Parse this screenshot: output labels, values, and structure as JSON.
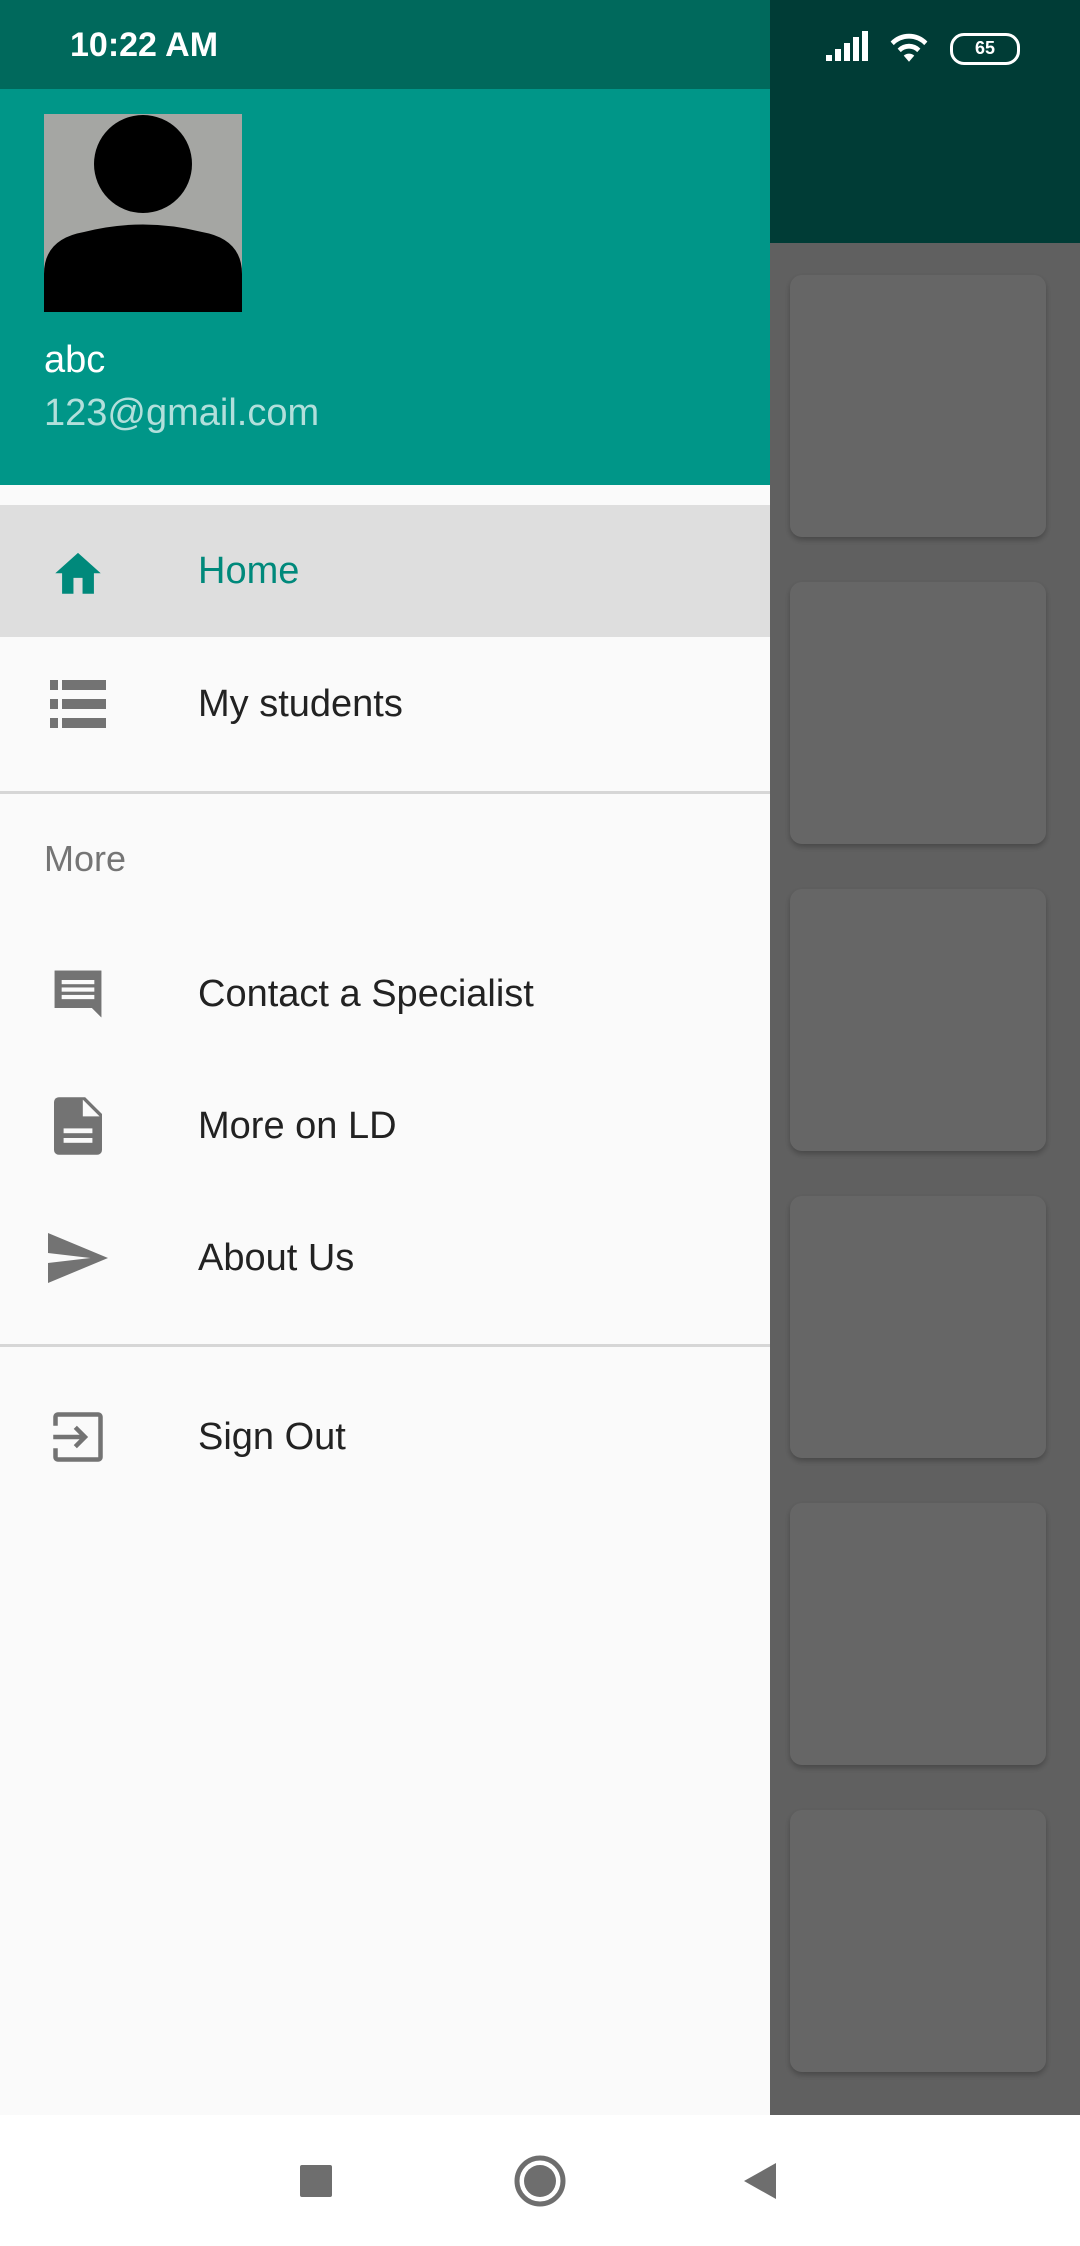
{
  "status_bar": {
    "time": "10:22 AM",
    "battery_level": "65",
    "icons": [
      "signal-icon",
      "wifi-icon",
      "battery-icon"
    ]
  },
  "drawer": {
    "user": {
      "name": "abc",
      "email": "123@gmail.com",
      "avatar_icon": "person-icon"
    },
    "primary_items": [
      {
        "label": "Home",
        "icon": "home-icon",
        "active": true
      },
      {
        "label": "My students",
        "icon": "list-icon",
        "active": false
      }
    ],
    "section_title": "More",
    "more_items": [
      {
        "label": "Contact a Specialist",
        "icon": "chat-icon"
      },
      {
        "label": "More on LD",
        "icon": "document-icon"
      },
      {
        "label": "About Us",
        "icon": "send-icon"
      }
    ],
    "sign_out": {
      "label": "Sign Out",
      "icon": "exit-icon"
    }
  },
  "nav_bar": {
    "buttons": [
      "recents-icon",
      "home-circle-icon",
      "back-icon"
    ]
  },
  "colors": {
    "primary": "#009688",
    "primary_dark": "#00695c",
    "active_text": "#00897b",
    "active_bg": "#dedede",
    "drawer_bg": "#fafafa"
  }
}
